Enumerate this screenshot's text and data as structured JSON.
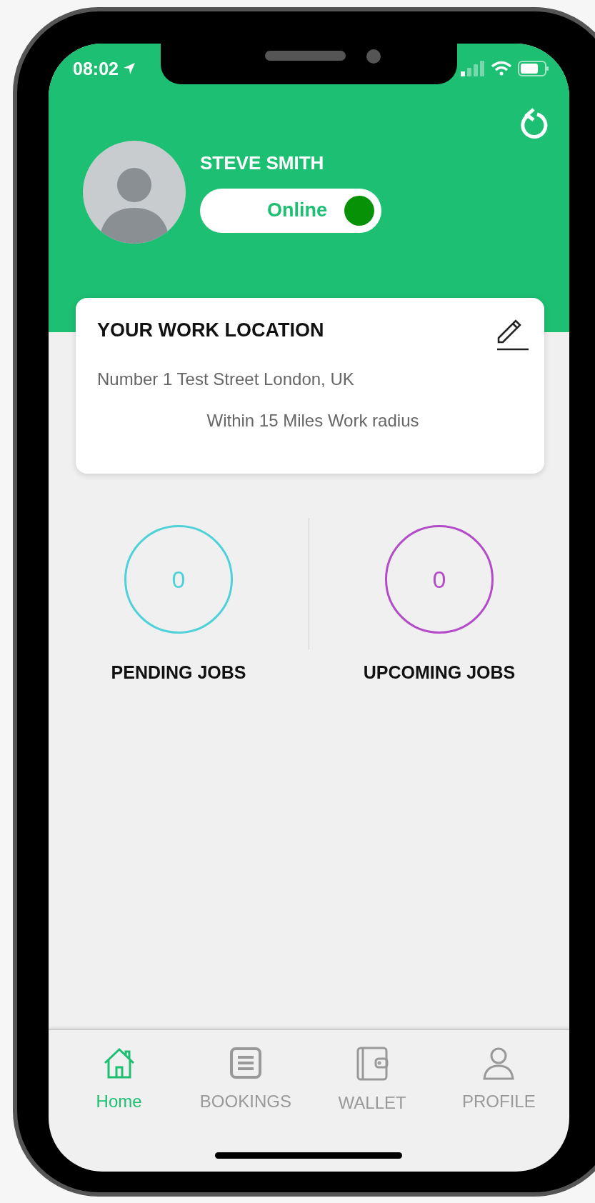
{
  "status_bar": {
    "time": "08:02"
  },
  "profile": {
    "name": "STEVE SMITH",
    "status": {
      "label": "Online",
      "on": true
    }
  },
  "work_location": {
    "title": "YOUR WORK LOCATION",
    "address": "Number 1 Test Street London, UK",
    "radius": "Within 15 Miles Work radius"
  },
  "stats": [
    {
      "value": "0",
      "label": "PENDING JOBS",
      "color": "#4fd1d9"
    },
    {
      "value": "0",
      "label": "UPCOMING JOBS",
      "color": "#b44bc9"
    }
  ],
  "tabs": [
    {
      "label": "Home",
      "selected": true
    },
    {
      "label": "BOOKINGS",
      "selected": false
    },
    {
      "label": "WALLET",
      "selected": false
    },
    {
      "label": "PROFILE",
      "selected": false
    }
  ]
}
